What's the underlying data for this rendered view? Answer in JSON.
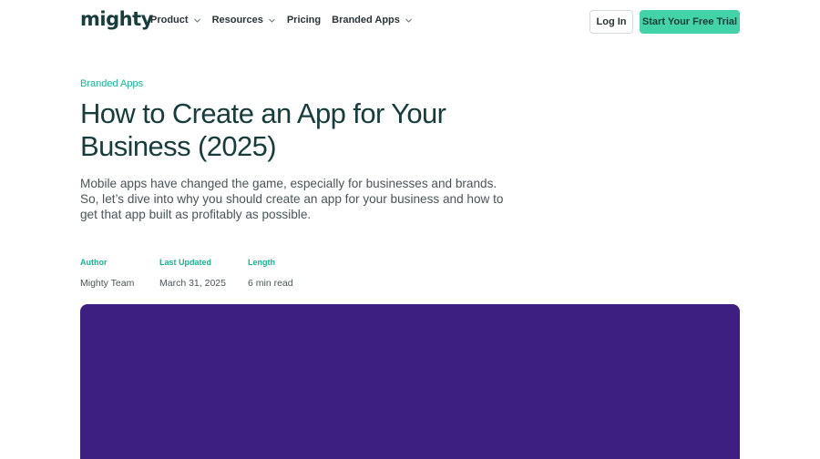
{
  "header": {
    "logo_text": "mighty",
    "nav": [
      {
        "label": "Product",
        "has_dropdown": true
      },
      {
        "label": "Resources",
        "has_dropdown": true
      },
      {
        "label": "Pricing",
        "has_dropdown": false
      },
      {
        "label": "Branded Apps",
        "has_dropdown": true
      }
    ],
    "login_label": "Log In",
    "cta_label": "Start Your Free Trial"
  },
  "article": {
    "category": "Branded Apps",
    "title": "How to Create an App for Your Business (2025)",
    "intro": "Mobile apps have changed the game, especially for businesses and brands. So, let’s dive into why you should create an app for your business and how to get that app built as profitably as possible.",
    "meta": [
      {
        "label": "Author",
        "value": "Mighty Team"
      },
      {
        "label": "Last Updated",
        "value": "March 31, 2025"
      },
      {
        "label": "Length",
        "value": "6 min read"
      }
    ]
  },
  "colors": {
    "accent": "#43d3a8",
    "accent_text": "#16b593",
    "heading": "#173c3c",
    "hero_bg": "#3d1f82"
  },
  "icons": {
    "dropdown": "chevron-down-icon"
  }
}
